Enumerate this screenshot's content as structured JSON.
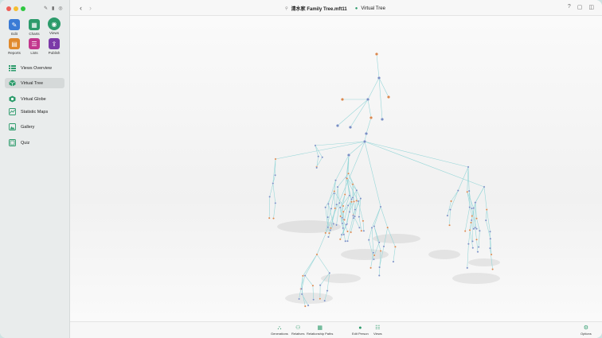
{
  "window": {
    "title_file": "清水家 Family Tree.mft11",
    "title_view": "Virtual Tree"
  },
  "toolbar": {
    "edit": "Edit",
    "charts": "Charts",
    "views": "Views",
    "reports": "Reports",
    "lists": "Lists",
    "publish": "Publish"
  },
  "sidebar": {
    "items": [
      {
        "label": "Views Overview"
      },
      {
        "label": "Virtual Tree"
      },
      {
        "label": "Virtual Globe"
      },
      {
        "label": "Statistic Maps"
      },
      {
        "label": "Gallery"
      },
      {
        "label": "Quiz"
      }
    ]
  },
  "bottombar": {
    "generations": "Generations",
    "relatives": "Relatives",
    "relationship_paths": "Relationship Paths",
    "edit_person": "Edit Person",
    "views": "Views",
    "options": "Options"
  },
  "colors": {
    "accent": "#2c9b6b",
    "edit": "#3a7bd5",
    "charts": "#2c9b6b",
    "views": "#2c9b6b",
    "reports": "#e0892c",
    "lists": "#c2378e",
    "publish": "#7b3aa8",
    "edge": "#8fd4d6",
    "male": "#7a8fc4",
    "female": "#d9874f"
  }
}
